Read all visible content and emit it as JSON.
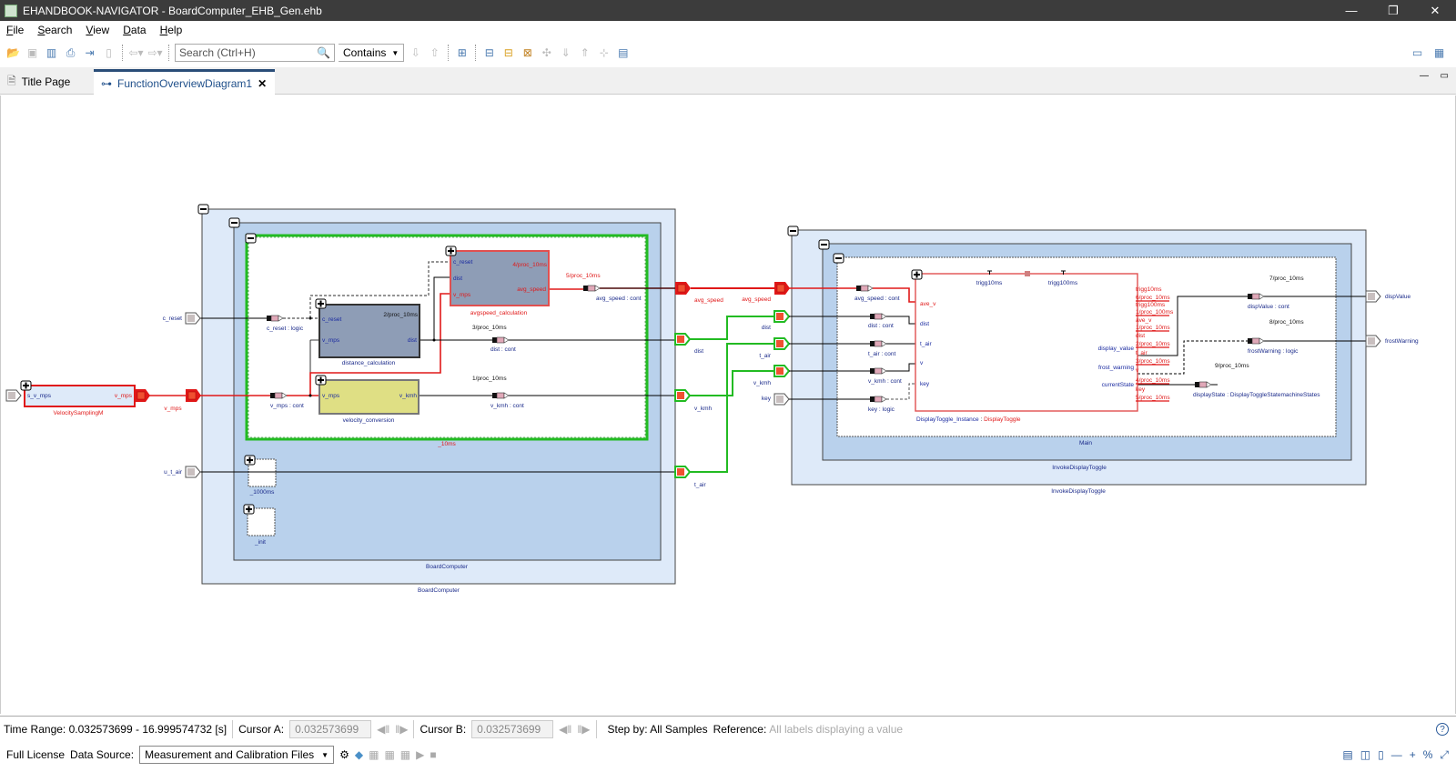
{
  "window": {
    "title": "EHANDBOOK-NAVIGATOR - BoardComputer_EHB_Gen.ehb"
  },
  "menu": [
    "File",
    "Search",
    "View",
    "Data",
    "Help"
  ],
  "toolbar": {
    "search_placeholder": "Search (Ctrl+H)",
    "match_mode": "Contains"
  },
  "tabs": [
    {
      "label": "Title Page"
    },
    {
      "label": "FunctionOverviewDiagram1",
      "close": "✕"
    }
  ],
  "diagram": {
    "velocity_sampling": {
      "name": "VelocitySamplingM",
      "in": "s_v_mps",
      "out": "v_mps",
      "signal": "v_mps"
    },
    "board_computer": {
      "outer_label": "BoardComputer",
      "inner_label": "BoardComputer",
      "task_10ms": "_10ms",
      "task_1000ms": "_1000ms",
      "task_init": "_init"
    },
    "inputs": {
      "c_reset": "c_reset",
      "u_t_air": "u_t_air"
    },
    "distance_calc": {
      "name": "distance_calculation",
      "in1": "c_reset",
      "in2": "v_mps",
      "proc": "2/proc_10ms",
      "out": "dist"
    },
    "velocity_conv": {
      "name": "velocity_conversion",
      "in": "v_mps",
      "out": "v_kmh"
    },
    "avgspeed_calc": {
      "name": "avgspeed_calculation",
      "in1": "c_reset",
      "in2": "dist",
      "in3": "v_mps",
      "proc": "4/proc_10ms",
      "out": "avg_speed"
    },
    "bc_signals": {
      "c_reset": "c_reset : logic",
      "v_mps": "v_mps : cont",
      "dist_proc": "3/proc_10ms",
      "dist": "dist : cont",
      "vkmh_proc": "1/proc_10ms",
      "vkmh": "v_kmh : cont",
      "avg_proc": "5/proc_10ms",
      "avg": "avg_speed : cont"
    },
    "bc_outports": {
      "avg_speed": "avg_speed",
      "dist": "dist",
      "v_kmh": "v_kmh",
      "t_air": "t_air"
    },
    "idt_inports": {
      "avg_speed": "avg_speed",
      "dist": "dist",
      "t_air": "t_air",
      "v_kmh": "v_kmh",
      "key": "key"
    },
    "invoke": {
      "outer_label": "InvokeDisplayToggle",
      "inner_label": "InvokeDisplayToggle",
      "main_label": "Main"
    },
    "idt_signals": {
      "avg": "avg_speed : cont",
      "dist": "dist : cont",
      "t_air": "t_air : cont",
      "v_kmh": "v_kmh : cont",
      "key": "key : logic"
    },
    "display_toggle": {
      "instance": "DisplayToggle_Instance",
      "sep": " : ",
      "type": "DisplayToggle",
      "in": [
        "ave_v",
        "dist",
        "t_air",
        "v",
        "key"
      ],
      "triggers": [
        "trigg10ms",
        "trigg100ms"
      ],
      "out": [
        "display_value",
        "frost_warning",
        "currentState"
      ],
      "side_labels": [
        "trigg10ms",
        "6/proc_10ms",
        "trigg100ms",
        "1/proc_100ms",
        "ave_v",
        "1/proc_10ms",
        "dist",
        "2/proc_10ms",
        "t_air",
        "3/proc_10ms",
        "v",
        "4/proc_10ms",
        "key",
        "5/proc_10ms"
      ]
    },
    "out_signals": {
      "disp_proc": "7/proc_10ms",
      "disp": "dispValue : cont",
      "frost_proc": "8/proc_10ms",
      "frost": "frostWarning : logic",
      "state_proc": "9/proc_10ms",
      "state": "displayState : DisplayToggleStatemachineStates"
    },
    "outports": {
      "disp": "dispValue",
      "frost": "frostWarning"
    },
    "colors": {
      "active_signal": "#e01818",
      "connector": "#22bb22",
      "task_border": "#22bb22"
    }
  },
  "status": {
    "time_range": "Time Range: 0.032573699 - 16.999574732 [s]",
    "cursor_a_label": "Cursor A:",
    "cursor_a": "0.032573699",
    "cursor_b_label": "Cursor B:",
    "cursor_b": "0.032573699",
    "step_by": "Step by: All Samples",
    "reference_label": "Reference:",
    "reference": "All labels displaying a value"
  },
  "bottom": {
    "license": "Full License",
    "data_source_label": "Data Source:",
    "data_source": "Measurement and Calibration Files"
  }
}
